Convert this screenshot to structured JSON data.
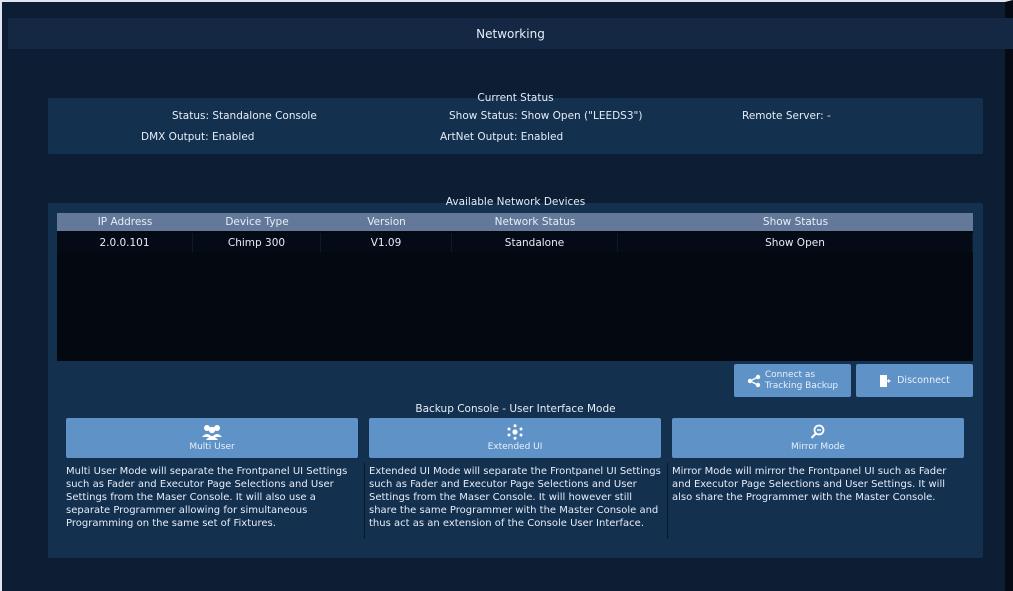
{
  "window": {
    "title": "Networking"
  },
  "current_status": {
    "heading": "Current Status",
    "status": "Status: Standalone Console",
    "show_status": "Show Status: Show Open (\"LEEDS3\")",
    "remote_server": "Remote Server: -",
    "dmx_output": "DMX Output: Enabled",
    "artnet_output": "ArtNet Output: Enabled"
  },
  "devices": {
    "heading": "Available Network Devices",
    "columns": [
      "IP Address",
      "Device Type",
      "Version",
      "Network Status",
      "Show Status"
    ],
    "rows": [
      [
        "2.0.0.101",
        "Chimp 300",
        "V1.09",
        "Standalone",
        "Show Open"
      ]
    ],
    "connect_label_1": "Connect as",
    "connect_label_2": "Tracking Backup",
    "disconnect_label": "Disconnect"
  },
  "backup": {
    "heading": "Backup Console - User Interface Mode",
    "modes": [
      {
        "label": "Multi User",
        "icon": "users-icon",
        "desc": "Multi User Mode will separate the Frontpanel UI Settings such as Fader and Executor Page Selections and User Settings from the Maser Console. It will also use a separate Programmer allowing for simultaneous Programming on the same set of Fixtures."
      },
      {
        "label": "Extended UI",
        "icon": "network-icon",
        "desc": "Extended UI Mode will separate the Frontpanel UI Settings such as Fader and Executor Page Selections and User Settings from the Maser Console. It will however still share the same Programmer with the Master Console and thus act as an extension of the Console User Interface."
      },
      {
        "label": "Mirror Mode",
        "icon": "mirror-icon",
        "desc": "Mirror Mode will mirror the Frontpanel UI such as Fader and Executor Page Selections and User Settings. It will also share the Programmer with the Master Console."
      }
    ]
  },
  "colors": {
    "background": "#0c1d34",
    "panel": "#14304f",
    "button": "#5f92c7",
    "table_header": "#64799a"
  }
}
